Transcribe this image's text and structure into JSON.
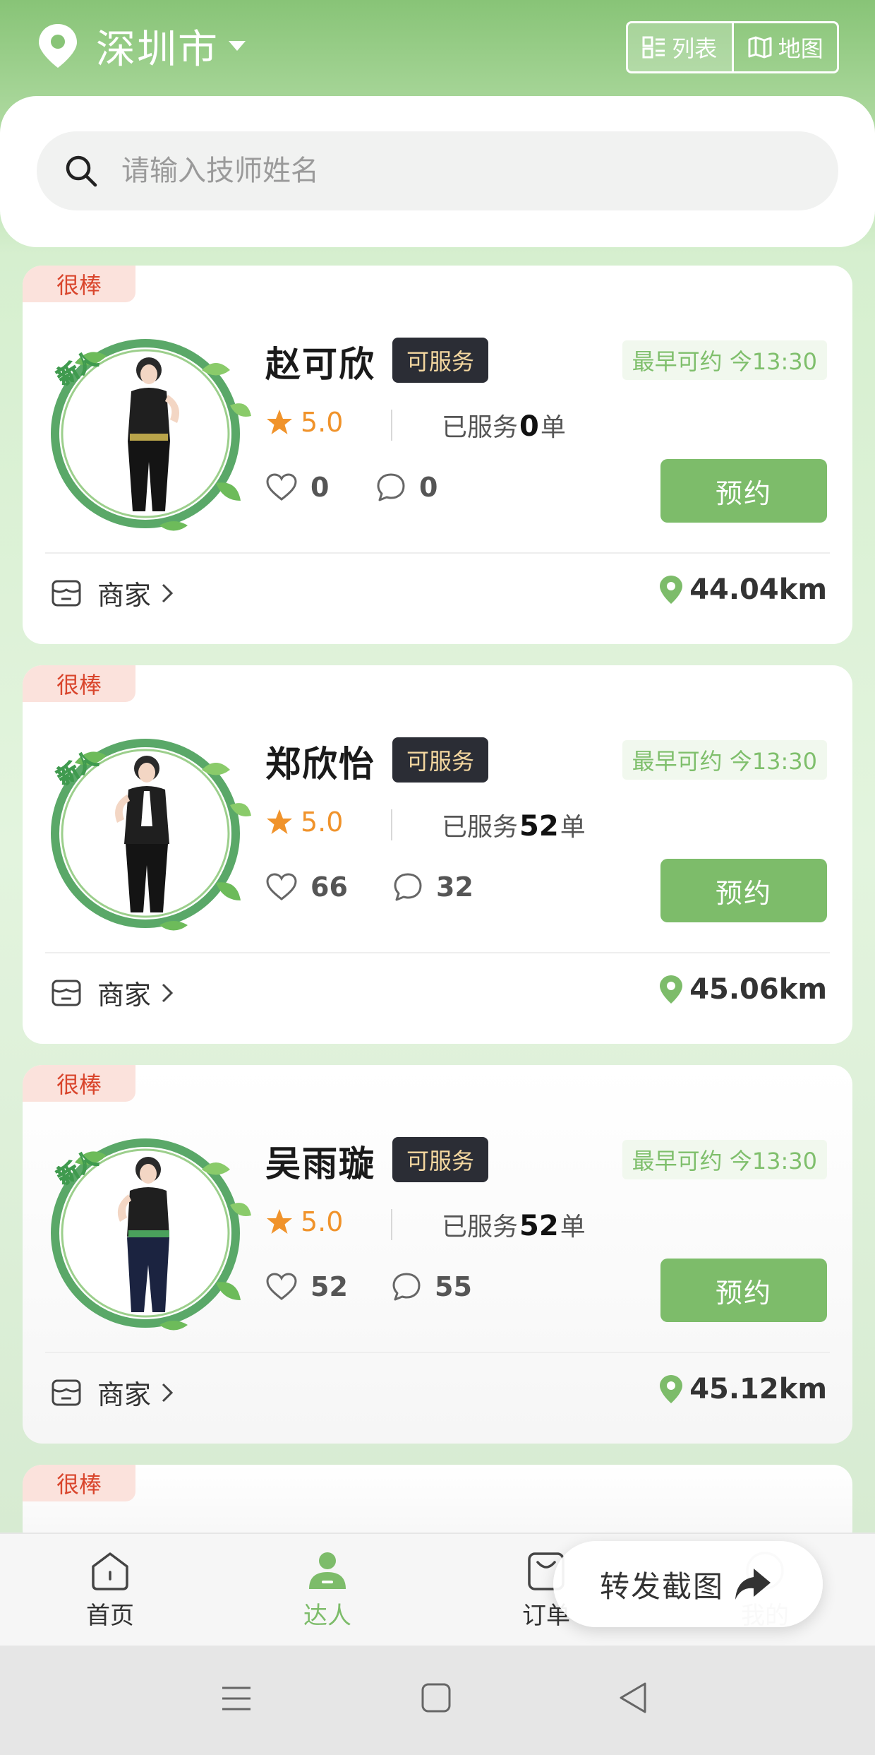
{
  "header": {
    "city": "深圳市",
    "view_toggle": {
      "list_label": "列表",
      "map_label": "地图",
      "active": "list"
    }
  },
  "search": {
    "placeholder": "请输入技师姓名"
  },
  "cards": [
    {
      "tag": "很棒",
      "badge": "新人",
      "name": "赵可欣",
      "status": "可服务",
      "earliest": "最早可约 今13:30",
      "rating": "5.0",
      "served_prefix": "已服务",
      "served_count": "0",
      "served_suffix": "单",
      "likes": "0",
      "comments": "0",
      "book_label": "预约",
      "merchant_label": "商家",
      "distance": "44.04km"
    },
    {
      "tag": "很棒",
      "badge": "新人",
      "name": "郑欣怡",
      "status": "可服务",
      "earliest": "最早可约 今13:30",
      "rating": "5.0",
      "served_prefix": "已服务",
      "served_count": "52",
      "served_suffix": "单",
      "likes": "66",
      "comments": "32",
      "book_label": "预约",
      "merchant_label": "商家",
      "distance": "45.06km"
    },
    {
      "tag": "很棒",
      "badge": "新人",
      "name": "吴雨璇",
      "status": "可服务",
      "earliest": "最早可约 今13:30",
      "rating": "5.0",
      "served_prefix": "已服务",
      "served_count": "52",
      "served_suffix": "单",
      "likes": "52",
      "comments": "55",
      "book_label": "预约",
      "merchant_label": "商家",
      "distance": "45.12km"
    }
  ],
  "partial_card": {
    "tag": "很棒"
  },
  "tabbar": {
    "home": "首页",
    "talent": "达人",
    "orders": "订单",
    "mine": "我的",
    "active": "talent"
  },
  "floating": {
    "forward_screenshot": "转发截图"
  },
  "colors": {
    "brand_green": "#7dbc6a",
    "header_green": "#88c477",
    "tag_red": "#d9452c",
    "star_orange": "#f0932b",
    "status_dark": "#2b2d35"
  }
}
